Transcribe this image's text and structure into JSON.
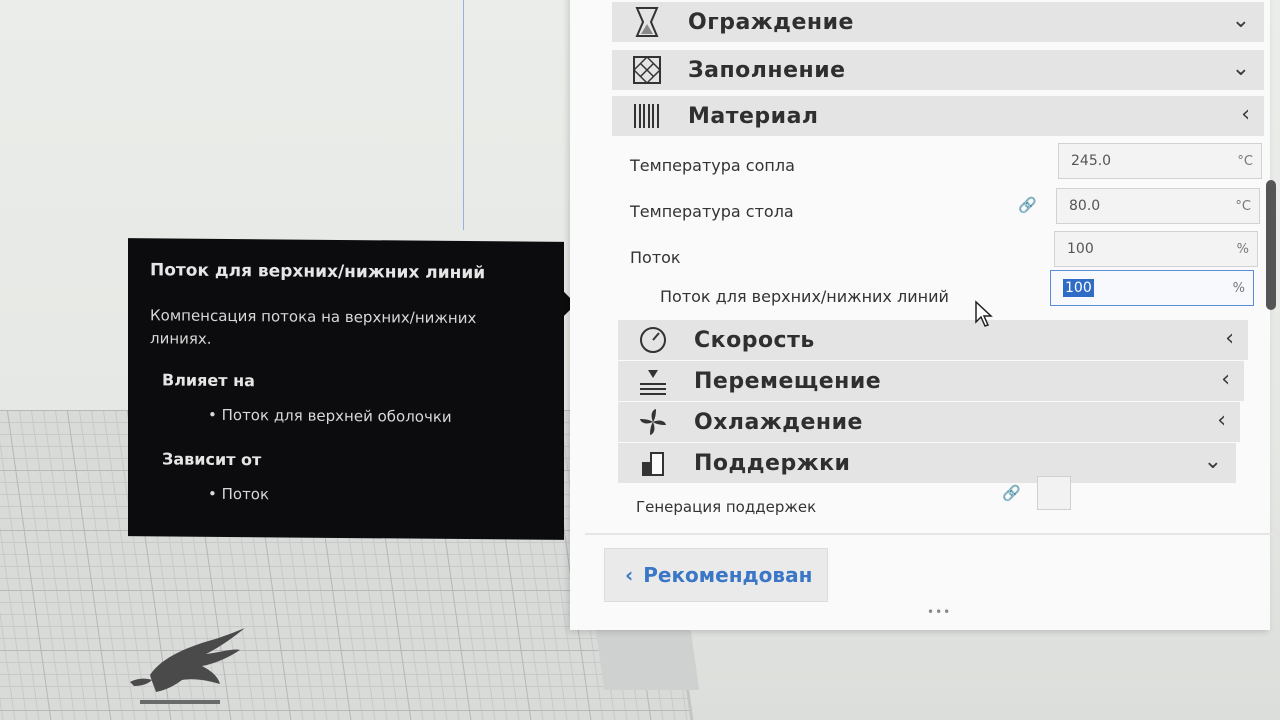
{
  "sections": [
    {
      "label": "Ограждение",
      "icon": "shell-icon",
      "chevron": "chevron-down-icon"
    },
    {
      "label": "Заполнение",
      "icon": "infill-icon",
      "chevron": "chevron-down-icon"
    },
    {
      "label": "Материал",
      "icon": "material-icon",
      "chevron": "chevron-left-icon"
    },
    {
      "label": "Скорость",
      "icon": "speed-icon",
      "chevron": "chevron-left-icon"
    },
    {
      "label": "Перемещение",
      "icon": "travel-icon",
      "chevron": "chevron-left-icon"
    },
    {
      "label": "Охлаждение",
      "icon": "fan-icon",
      "chevron": "chevron-left-icon"
    },
    {
      "label": "Поддержки",
      "icon": "support-icon",
      "chevron": "chevron-down-icon"
    }
  ],
  "material": {
    "nozzle_temp": {
      "label": "Температура сопла",
      "value": "245.0",
      "unit": "°C"
    },
    "bed_temp": {
      "label": "Температура стола",
      "value": "80.0",
      "unit": "°C"
    },
    "flow": {
      "label": "Поток",
      "value": "100",
      "unit": "%"
    },
    "top_bottom_flow": {
      "label": "Поток для верхних/нижних линий",
      "value": "100",
      "unit": "%"
    }
  },
  "support": {
    "generate_label": "Генерация поддержек"
  },
  "tooltip": {
    "title": "Поток для верхних/нижних линий",
    "description": "Компенсация потока на верхних/нижних линиях.",
    "affects_heading": "Влияет на",
    "affects_item": "• Поток для верхней оболочки",
    "depends_heading": "Зависит от",
    "depends_item": "• Поток"
  },
  "recommended_button": "Рекомендован",
  "colors": {
    "accent": "#3b77c6",
    "tooltip_bg": "#0c0b0d",
    "section_bg": "#e4e4e4"
  }
}
